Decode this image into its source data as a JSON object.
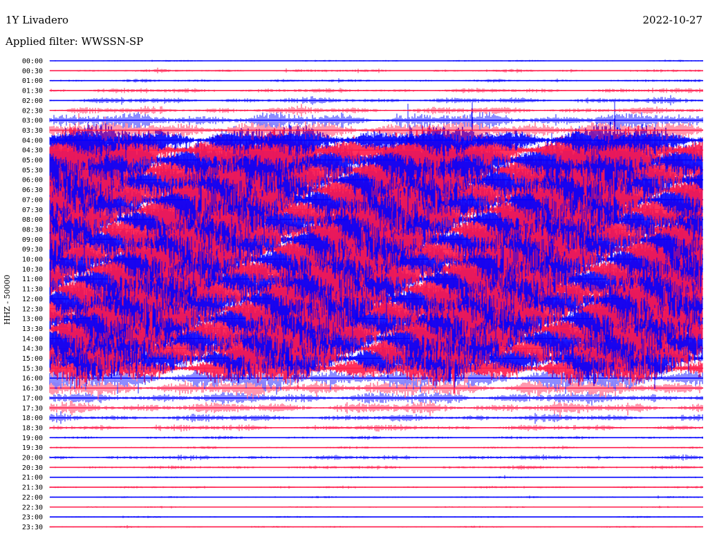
{
  "header": {
    "station": "1Y Livadero",
    "date": "2022-10-27",
    "filter": "Applied filter: WWSSN-SP"
  },
  "chart_data": {
    "type": "line",
    "title": "1Y Livadero",
    "ylabel": "HHZ - 50000",
    "x_range_minutes": [
      0,
      30
    ],
    "row_labels": [
      "00:00",
      "00:30",
      "01:00",
      "01:30",
      "02:00",
      "02:30",
      "03:00",
      "03:30",
      "04:00",
      "04:30",
      "05:00",
      "05:30",
      "06:00",
      "06:30",
      "07:00",
      "07:30",
      "08:00",
      "08:30",
      "09:00",
      "09:30",
      "10:00",
      "10:30",
      "11:00",
      "11:30",
      "12:00",
      "12:30",
      "13:00",
      "13:30",
      "14:00",
      "14:30",
      "15:00",
      "15:30",
      "16:00",
      "16:30",
      "17:00",
      "17:30",
      "18:00",
      "18:30",
      "19:00",
      "19:30",
      "20:00",
      "20:30",
      "21:00",
      "21:30",
      "22:00",
      "22:30",
      "23:00",
      "23:30"
    ],
    "colors": {
      "blue": "#0000ff",
      "red": "#ff1a4a"
    },
    "color_pattern": [
      "blue",
      "red"
    ],
    "relative_amplitude": [
      0.03,
      0.05,
      0.05,
      0.08,
      0.1,
      0.12,
      0.25,
      0.35,
      0.5,
      0.75,
      1.0,
      1.0,
      1.0,
      1.0,
      1.0,
      1.0,
      1.0,
      1.0,
      1.0,
      1.0,
      1.0,
      1.0,
      1.0,
      1.0,
      1.0,
      1.0,
      1.0,
      1.0,
      1.0,
      0.9,
      0.75,
      0.55,
      0.4,
      0.3,
      0.2,
      0.18,
      0.12,
      0.1,
      0.05,
      0.04,
      0.08,
      0.06,
      0.03,
      0.04,
      0.03,
      0.03,
      0.03,
      0.03
    ]
  }
}
